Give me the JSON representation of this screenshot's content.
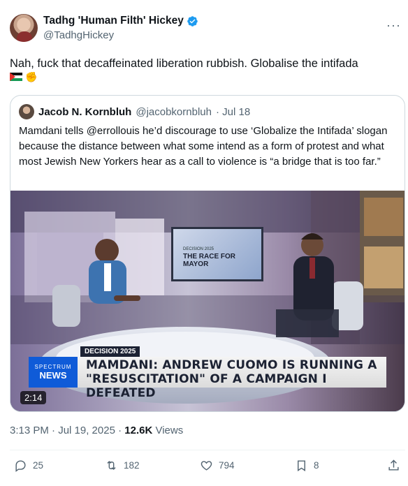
{
  "tweet": {
    "author_name": "Tadhg 'Human Filth' Hickey",
    "author_handle": "@TadhgHickey",
    "more_label": "···",
    "text": "Nah, fuck that decaffeinated liberation rubbish. Globalise the intifada",
    "emojis": [
      "palestine-flag",
      "raised-fist"
    ],
    "time": "3:13 PM · Jul 19, 2025 ·",
    "views_count": "12.6K",
    "views_label": "Views"
  },
  "quote": {
    "author_name": "Jacob N. Kornbluh",
    "author_handle": "@jacobkornbluh",
    "date": "· Jul 18",
    "text": "Mamdani tells @errollouis he’d discourage to use ‘Globalize the Intifada’ slogan because the distance between what some intend as a form of protest and what most Jewish New Yorkers hear as a call to violence is “a bridge that is too far.”",
    "video": {
      "duration": "2:14",
      "screen_small": "DECISION 2025",
      "screen_title": "THE RACE FOR MAYOR",
      "lower_tag": "DECISION 2025",
      "lower_logo_top": "SPECTRUM",
      "lower_logo_bottom": "NEWS",
      "headline_line1": "MAMDANI: ANDREW CUOMO IS RUNNING A",
      "headline_line2": "\"RESUSCITATION\" OF A CAMPAIGN I DEFEATED"
    }
  },
  "actions": {
    "replies": "25",
    "reposts": "182",
    "likes": "794",
    "bookmarks": "8"
  },
  "colors": {
    "verified": "#1d9bf0",
    "secondary_text": "#536471",
    "primary_text": "#0f1419",
    "border": "#cfd9de"
  }
}
